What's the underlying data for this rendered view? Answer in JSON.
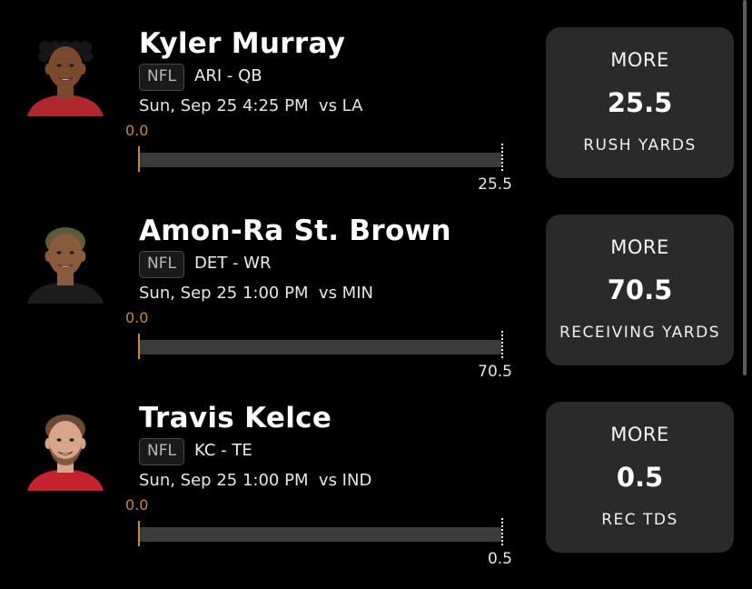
{
  "picks": [
    {
      "player_name": "Kyler Murray",
      "league": "NFL",
      "team_position": "ARI - QB",
      "game_info": "Sun, Sep 25 4:25 PM  vs LA",
      "progress": {
        "start_label": "0.0",
        "target_label": "25.5",
        "fraction": 0
      },
      "card": {
        "direction": "MORE",
        "line": "25.5",
        "stat": "RUSH YARDS"
      },
      "avatar": {
        "skin": "#7a4a2e",
        "hair": "#161616",
        "jersey": "#b0282e",
        "style": "curly"
      }
    },
    {
      "player_name": "Amon-Ra St. Brown",
      "league": "NFL",
      "team_position": "DET - WR",
      "game_info": "Sun, Sep 25 1:00 PM  vs MIN",
      "progress": {
        "start_label": "0.0",
        "target_label": "70.5",
        "fraction": 0
      },
      "card": {
        "direction": "MORE",
        "line": "70.5",
        "stat": "RECEIVING YARDS"
      },
      "avatar": {
        "skin": "#8a5a3c",
        "hair": "#5c5a3a",
        "jersey": "#1c1c1c",
        "style": "short"
      }
    },
    {
      "player_name": "Travis Kelce",
      "league": "NFL",
      "team_position": "KC - TE",
      "game_info": "Sun, Sep 25 1:00 PM  vs IND",
      "progress": {
        "start_label": "0.0",
        "target_label": "0.5",
        "fraction": 0
      },
      "card": {
        "direction": "MORE",
        "line": "0.5",
        "stat": "REC TDS"
      },
      "avatar": {
        "skin": "#d7a689",
        "hair": "#6b4a35",
        "jersey": "#c5232b",
        "style": "beard"
      }
    }
  ],
  "colors": {
    "background": "#000000",
    "card": "#2a2a2a",
    "track": "#3b3b3b",
    "accent": "#c58a3a"
  }
}
